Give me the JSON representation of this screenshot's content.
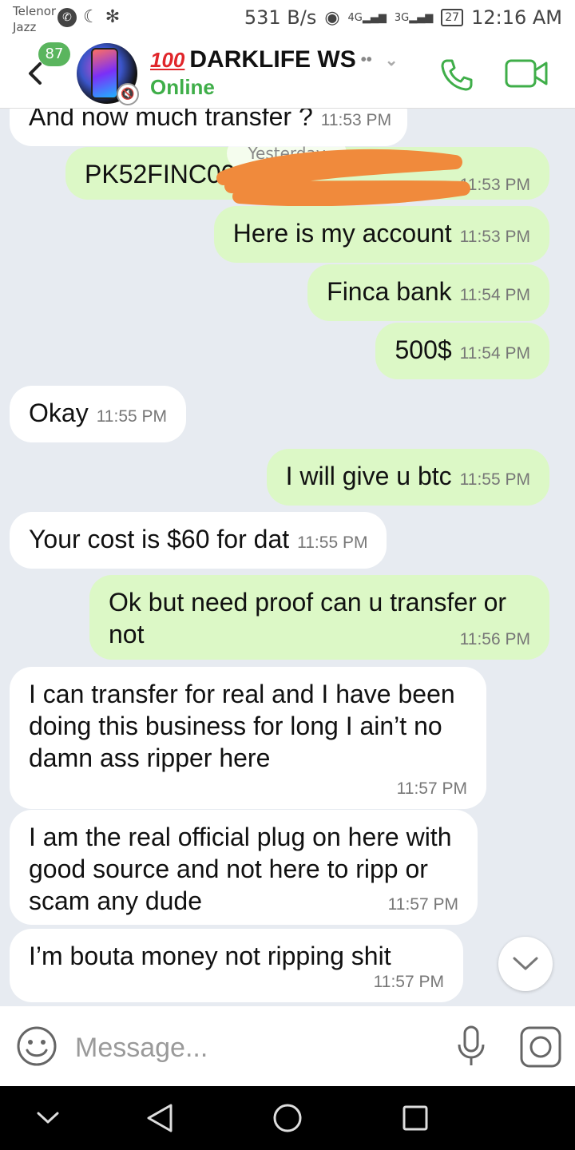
{
  "status_bar": {
    "carrier_line1": "Telenor",
    "carrier_line2": "Jazz",
    "speed": "531 B/s",
    "net_4g": "4G",
    "net_3g": "3G",
    "battery": "27",
    "time": "12:16 AM"
  },
  "header": {
    "unread_count": "87",
    "hundred_emoji": "100",
    "contact_name": "DARKLIFE WS",
    "eyes": "••",
    "presence": "Online"
  },
  "messages": [
    {
      "dir": "in",
      "text": "And now much transfer ?",
      "time": "11:53 PM"
    },
    {
      "dir": "out",
      "text": "PK52FINC00",
      "time": "11:53 PM"
    },
    {
      "dir": "out",
      "text": "Here is my account",
      "time": "11:53 PM"
    },
    {
      "dir": "out",
      "text": "Finca bank",
      "time": "11:54 PM"
    },
    {
      "dir": "out",
      "text": "500$",
      "time": "11:54 PM"
    },
    {
      "dir": "in",
      "text": "Okay",
      "time": "11:55 PM"
    },
    {
      "dir": "out",
      "text": "I will give u btc",
      "time": "11:55 PM"
    },
    {
      "dir": "in",
      "text": "Your cost is $60 for dat",
      "time": "11:55 PM"
    },
    {
      "dir": "out",
      "text": "Ok but need proof can u transfer or not",
      "time": "11:56 PM"
    },
    {
      "dir": "in",
      "text": "I can transfer for real and I have been doing this business for long I ain’t no damn ass ripper here",
      "time": "11:57 PM"
    },
    {
      "dir": "in",
      "text": "I am the real official plug on here with good source and not here to ripp or scam any dude",
      "time": "11:57 PM"
    },
    {
      "dir": "in",
      "text": "I’m bouta money not ripping shit",
      "time": "11:57 PM"
    }
  ],
  "date_chip": "Yesterday",
  "composer": {
    "placeholder": "Message..."
  },
  "icons": {
    "back": "back-arrow-icon",
    "call": "phone-icon",
    "video": "video-camera-icon",
    "emoji": "emoji-icon",
    "mic": "microphone-icon",
    "camera": "camera-icon"
  },
  "colors": {
    "accent_green": "#3fae49",
    "outgoing_bubble": "#dcf8c6",
    "incoming_bubble": "#ffffff",
    "chat_background": "#e7ebf1",
    "redaction": "#f08a3c"
  }
}
